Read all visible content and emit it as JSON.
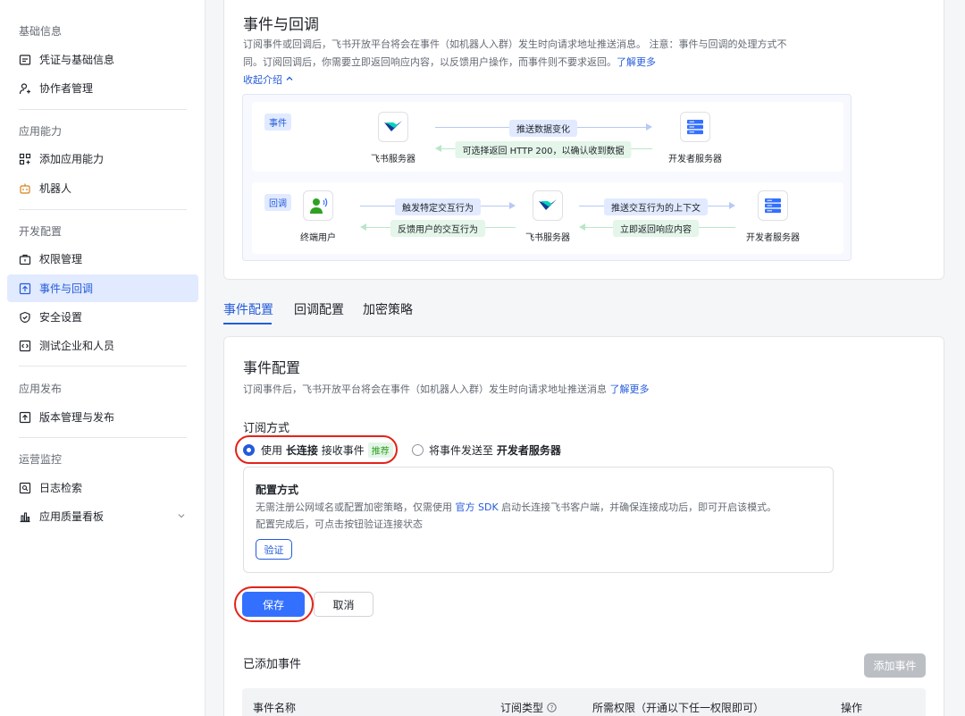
{
  "sidebar": {
    "groups": [
      {
        "title": "基础信息",
        "items": [
          {
            "label": "凭证与基础信息",
            "icon": "credential-icon"
          },
          {
            "label": "协作者管理",
            "icon": "add-user-icon"
          }
        ]
      },
      {
        "title": "应用能力",
        "items": [
          {
            "label": "添加应用能力",
            "icon": "apps-add-icon"
          },
          {
            "label": "机器人",
            "icon": "robot-icon"
          }
        ]
      },
      {
        "title": "开发配置",
        "items": [
          {
            "label": "权限管理",
            "icon": "permission-icon"
          },
          {
            "label": "事件与回调",
            "icon": "event-icon"
          },
          {
            "label": "安全设置",
            "icon": "shield-icon"
          },
          {
            "label": "测试企业和人员",
            "icon": "code-icon"
          }
        ]
      },
      {
        "title": "应用发布",
        "items": [
          {
            "label": "版本管理与发布",
            "icon": "upload-icon"
          }
        ]
      },
      {
        "title": "运营监控",
        "items": [
          {
            "label": "日志检索",
            "icon": "log-search-icon"
          },
          {
            "label": "应用质量看板",
            "icon": "chart-bar-icon"
          }
        ]
      }
    ],
    "active_item": "事件与回调"
  },
  "intro": {
    "title": "事件与回调",
    "desc_line1": "订阅事件或回调后，飞书开放平台将会在事件（如机器人入群）发生时向请求地址推送消息。 注意：事件与回调的处理方式不",
    "desc_line2": "同。订阅回调后，你需要立即返回响应内容，以反馈用户操作，而事件则不要求返回。",
    "learn_more": "了解更多",
    "collapse": "收起介绍"
  },
  "diagram": {
    "event_tag": "事件",
    "callback_tag": "回调",
    "feishu_server": "飞书服务器",
    "dev_server": "开发者服务器",
    "end_user": "终端用户",
    "event_push": "推送数据变化",
    "event_return": "可选择返回 HTTP 200，以确认收到数据",
    "cb_trigger": "触发特定交互行为",
    "cb_feedback": "反馈用户的交互行为",
    "cb_push": "推送交互行为的上下文",
    "cb_return": "立即返回响应内容"
  },
  "tabs": [
    "事件配置",
    "回调配置",
    "加密策略"
  ],
  "config": {
    "title": "事件配置",
    "desc": "订阅事件后，飞书开放平台将会在事件（如机器人入群）发生时向请求地址推送消息",
    "learn_more": "了解更多",
    "subscribe_label": "订阅方式",
    "option1_pre": "使用",
    "option1_bold": "长连接",
    "option1_post": "接收事件",
    "option1_badge": "推荐",
    "option2_pre": "将事件发送至",
    "option2_bold": "开发者服务器",
    "mode_title": "配置方式",
    "mode_desc1_pre": "无需注册公网域名或配置加密策略，仅需使用",
    "mode_desc1_link": "官方 SDK",
    "mode_desc1_post": "启动长连接飞书客户端，并确保连接成功后，即可开启该模式。",
    "mode_desc2": "配置完成后，可点击按钮验证连接状态",
    "verify": "验证",
    "save": "保存",
    "cancel": "取消",
    "added_title": "已添加事件",
    "add_event": "添加事件",
    "columns": [
      "事件名称",
      "订阅类型",
      "所需权限（开通以下任一权限即可）",
      "操作"
    ]
  },
  "colors": {
    "accent": "#3370ff",
    "annotation": "#e2231a",
    "active_bg": "#e1eaff"
  }
}
